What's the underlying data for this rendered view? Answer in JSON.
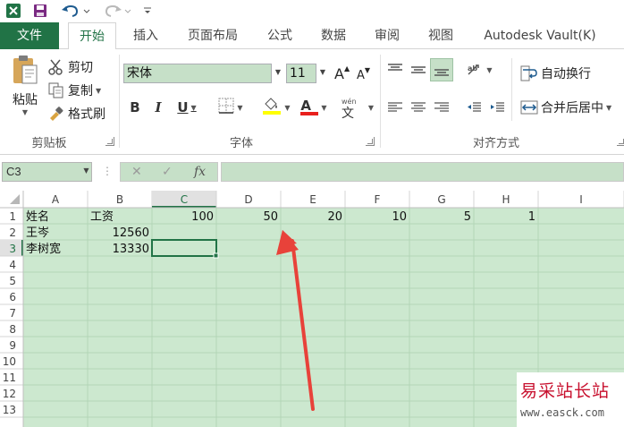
{
  "ribbon_tabs": {
    "file": "文件",
    "home": "开始",
    "insert": "插入",
    "page_layout": "页面布局",
    "formulas": "公式",
    "data": "数据",
    "review": "审阅",
    "view": "视图",
    "vault": "Autodesk Vault(K)"
  },
  "clipboard": {
    "paste": "粘贴",
    "cut": "剪切",
    "copy": "复制",
    "format_painter": "格式刷",
    "group": "剪贴板"
  },
  "font": {
    "name": "宋体",
    "size": "11",
    "bold": "B",
    "italic": "I",
    "underline": "U",
    "grow": "A",
    "shrink": "A",
    "color_letter": "A",
    "phonetic_top": "wén",
    "phonetic_char": "文",
    "group": "字体"
  },
  "alignment": {
    "wrap_text": "自动换行",
    "merge_center": "合并后居中",
    "group": "对齐方式"
  },
  "formula_bar": {
    "name_box": "C3",
    "fx": "fx",
    "content": ""
  },
  "sheet": {
    "columns": [
      "A",
      "B",
      "C",
      "D",
      "E",
      "F",
      "G",
      "H",
      "I"
    ],
    "rows": [
      "1",
      "2",
      "3",
      "4",
      "5",
      "6",
      "7",
      "8",
      "9",
      "10",
      "11",
      "12",
      "13"
    ],
    "active_column": "C",
    "active_row": "3",
    "cells": [
      {
        "ref": "A1",
        "value": "姓名"
      },
      {
        "ref": "B1",
        "value": "工资"
      },
      {
        "ref": "C1",
        "value": "100"
      },
      {
        "ref": "D1",
        "value": "50"
      },
      {
        "ref": "E1",
        "value": "20"
      },
      {
        "ref": "F1",
        "value": "10"
      },
      {
        "ref": "G1",
        "value": "5"
      },
      {
        "ref": "H1",
        "value": "1"
      },
      {
        "ref": "A2",
        "value": "王岑"
      },
      {
        "ref": "B2",
        "value": "12560"
      },
      {
        "ref": "A3",
        "value": "李树宽"
      },
      {
        "ref": "B3",
        "value": "13330"
      }
    ]
  },
  "watermark": {
    "title": "易采站长站",
    "url": "www.easck.com"
  },
  "colors": {
    "excel_green": "#217346",
    "cell_bg": "#cce8cf",
    "arrow": "#e8423a"
  }
}
